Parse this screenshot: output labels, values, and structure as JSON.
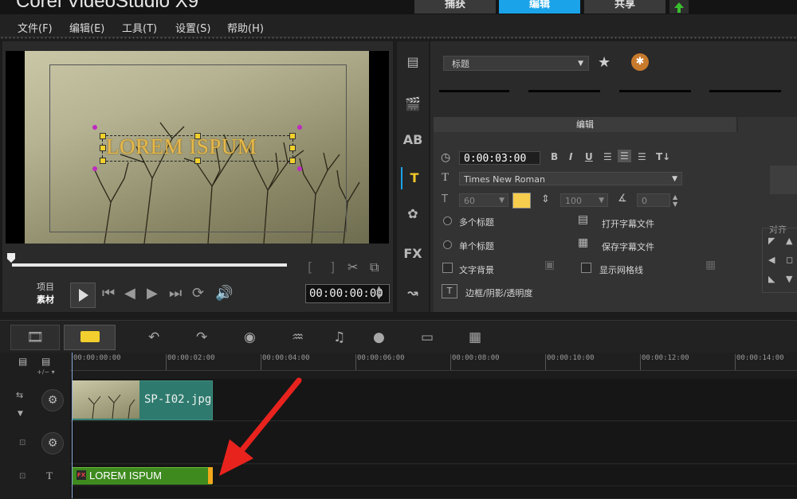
{
  "app": {
    "title": "Corel VideoStudio X9"
  },
  "steps": {
    "capture": "捕获",
    "edit": "编辑",
    "share": "共享"
  },
  "menu": {
    "file": "文件(F)",
    "edit": "编辑(E)",
    "tools": "工具(T)",
    "settings": "设置(S)",
    "help": "帮助(H)"
  },
  "player": {
    "overlay_text": "LOREM ISPUM",
    "mode_project": "项目",
    "mode_clip": "素材",
    "timecode": "00:00:00:00"
  },
  "library": {
    "category": "标题",
    "edit_tab": "编辑"
  },
  "title_options": {
    "duration": "0:00:03:00",
    "bold": "B",
    "italic": "I",
    "underline": "U",
    "font": "Times New Roman",
    "font_size": "60",
    "line_spacing": "100",
    "rotation": "0",
    "multi_title": "多个标题",
    "single_title": "单个标题",
    "open_subtitle": "打开字幕文件",
    "save_subtitle": "保存字幕文件",
    "text_background": "文字背景",
    "show_grid": "显示网格线",
    "border_shadow": "边框/阴影/透明度",
    "align_label": "对齐"
  },
  "colors": {
    "accent_tab": "#1aa3e8",
    "title_color": "#f6cd4c",
    "title_clip": "#3e8a1f",
    "video_clip": "#2f7a6e"
  },
  "timeline": {
    "ruler": [
      "00:00:00:00",
      "00:00:02:00",
      "00:00:04:00",
      "00:00:06:00",
      "00:00:08:00",
      "00:00:10:00",
      "00:00:12:00",
      "00:00:14:00"
    ],
    "video_clip": "SP-I02.jpg",
    "title_clip": "LOREM ISPUM",
    "fx_badge": "FX"
  }
}
